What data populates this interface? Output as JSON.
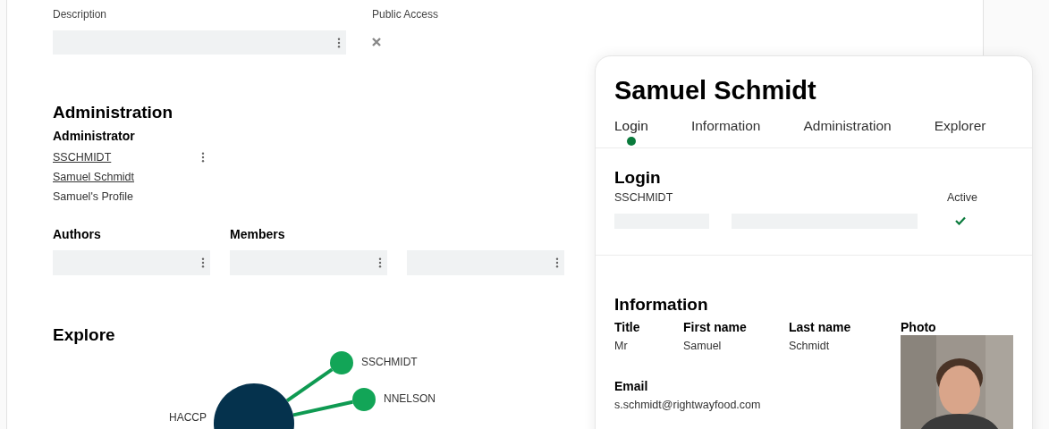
{
  "description": {
    "label": "Description"
  },
  "public_access": {
    "label": "Public Access",
    "checked": false
  },
  "administration": {
    "heading": "Administration",
    "admin_label": "Administrator",
    "admin_login": "SSCHMIDT",
    "admin_name": "Samuel Schmidt",
    "admin_profile": "Samuel's Profile",
    "authors_label": "Authors",
    "members_label": "Members"
  },
  "explore": {
    "heading": "Explore",
    "nodes": [
      {
        "label": "HACCP",
        "kind": "hub"
      },
      {
        "label": "SSCHMIDT",
        "kind": "leaf"
      },
      {
        "label": "NNELSON",
        "kind": "leaf"
      }
    ]
  },
  "profile_card": {
    "title": "Samuel Schmidt",
    "tabs": [
      {
        "label": "Login",
        "selected": true
      },
      {
        "label": "Information",
        "selected": false
      },
      {
        "label": "Administration",
        "selected": false
      },
      {
        "label": "Explorer",
        "selected": false
      }
    ],
    "login": {
      "heading": "Login",
      "username": "SSCHMIDT",
      "active_label": "Active",
      "active": true
    },
    "information": {
      "heading": "Information",
      "columns": [
        {
          "label": "Title",
          "value": "Mr"
        },
        {
          "label": "First name",
          "value": "Samuel"
        },
        {
          "label": "Last name",
          "value": "Schmidt"
        }
      ],
      "photo_label": "Photo",
      "email_label": "Email",
      "email": "s.schmidt@rightwayfood.com"
    }
  }
}
